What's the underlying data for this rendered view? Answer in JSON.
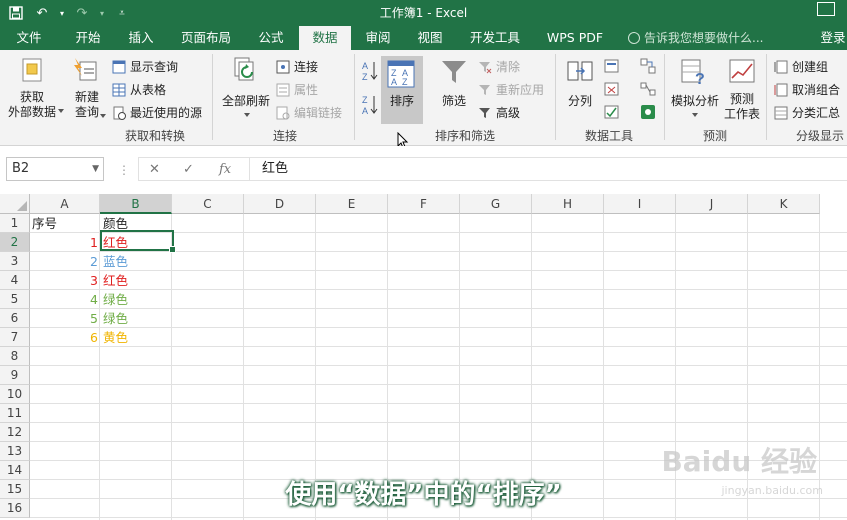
{
  "title": "工作簿1 - Excel",
  "quick_access": {
    "save_icon": "save-icon",
    "undo_icon": "undo-icon",
    "redo_icon": "redo-icon",
    "customize_icon": "customize-qat-icon"
  },
  "tabs": [
    {
      "label": "文件",
      "active": false
    },
    {
      "label": "开始",
      "active": false
    },
    {
      "label": "插入",
      "active": false
    },
    {
      "label": "页面布局",
      "active": false
    },
    {
      "label": "公式",
      "active": false
    },
    {
      "label": "数据",
      "active": true
    },
    {
      "label": "审阅",
      "active": false
    },
    {
      "label": "视图",
      "active": false
    },
    {
      "label": "开发工具",
      "active": false
    },
    {
      "label": "WPS PDF",
      "active": false
    }
  ],
  "tell_me": "告诉我您想要做什么...",
  "sign_in": "登录",
  "ribbon": {
    "get_external": {
      "line1": "获取",
      "line2": "外部数据"
    },
    "new_query": {
      "line1": "新建",
      "line2": "查询"
    },
    "show_queries": "显示查询",
    "from_table": "从表格",
    "recent_sources": "最近使用的源",
    "group_get_transform": "获取和转换",
    "refresh_all": "全部刷新",
    "connections": "连接",
    "properties": "属性",
    "edit_links": "编辑链接",
    "group_connections": "连接",
    "sort_az": "A↓Z",
    "sort_za": "Z↓A",
    "sort": "排序",
    "filter": "筛选",
    "clear": "清除",
    "reapply": "重新应用",
    "advanced": "高级",
    "group_sort_filter": "排序和筛选",
    "text_to_columns": "分列",
    "group_data_tools": "数据工具",
    "what_if": "模拟分析",
    "forecast_sheet": {
      "line1": "预测",
      "line2": "工作表"
    },
    "group_forecast": "预测",
    "group": "创建组",
    "ungroup": "取消组合",
    "subtotal": "分类汇总",
    "group_outline": "分级显示"
  },
  "name_box": "B2",
  "formula_value": "红色",
  "columns": [
    "A",
    "B",
    "C",
    "D",
    "E",
    "F",
    "G",
    "H",
    "I",
    "J",
    "K"
  ],
  "rows": [
    "1",
    "2",
    "3",
    "4",
    "5",
    "6",
    "7",
    "8",
    "9",
    "10",
    "11",
    "12",
    "13",
    "14",
    "15",
    "16"
  ],
  "cells": {
    "A1": "序号",
    "B1": "颜色",
    "data": [
      {
        "num": "1",
        "color_text": "红色",
        "color": "#e02020"
      },
      {
        "num": "2",
        "color_text": "蓝色",
        "color": "#5b9bd5"
      },
      {
        "num": "3",
        "color_text": "红色",
        "color": "#e02020"
      },
      {
        "num": "4",
        "color_text": "绿色",
        "color": "#70ad47"
      },
      {
        "num": "5",
        "color_text": "绿色",
        "color": "#70ad47"
      },
      {
        "num": "6",
        "color_text": "黄色",
        "color": "#f0b400"
      }
    ]
  },
  "caption": "使用“数据”中的“排序”",
  "watermark": "Baidu 经验",
  "watermark_url": "jingyan.baidu.com"
}
